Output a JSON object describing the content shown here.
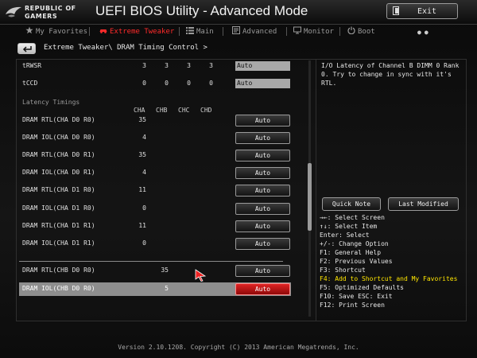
{
  "header": {
    "brand_line1": "REPUBLIC OF",
    "brand_line2": "GAMERS",
    "title": "UEFI BIOS Utility - Advanced Mode",
    "exit_label": "Exit"
  },
  "tabs": [
    {
      "label": "My Favorites",
      "icon": "star-icon",
      "active": false
    },
    {
      "label": "Extreme Tweaker",
      "icon": "car-icon",
      "active": true
    },
    {
      "label": "Main",
      "icon": "list-icon",
      "active": false
    },
    {
      "label": "Advanced",
      "icon": "advanced-icon",
      "active": false
    },
    {
      "label": "Monitor",
      "icon": "monitor-icon",
      "active": false
    },
    {
      "label": "Boot",
      "icon": "power-icon",
      "active": false
    }
  ],
  "breadcrumb": "Extreme Tweaker\\ DRAM Timing Control >",
  "timings_top": [
    {
      "label": "tRWSR",
      "values": [
        "3",
        "3",
        "3",
        "3"
      ],
      "setting": "Auto"
    },
    {
      "label": "tCCD",
      "values": [
        "0",
        "0",
        "0",
        "0"
      ],
      "setting": "Auto"
    }
  ],
  "latency_section": "Latency Timings",
  "columns": [
    "CHA",
    "CHB",
    "CHC",
    "CHD"
  ],
  "latency_rows": [
    {
      "label": "DRAM RTL(CHA D0 R0)",
      "value": "35",
      "button": "Auto"
    },
    {
      "label": "DRAM IOL(CHA D0 R0)",
      "value": "4",
      "button": "Auto"
    },
    {
      "label": "DRAM RTL(CHA D0 R1)",
      "value": "35",
      "button": "Auto"
    },
    {
      "label": "DRAM IOL(CHA D0 R1)",
      "value": "4",
      "button": "Auto"
    },
    {
      "label": "DRAM RTL(CHA D1 R0)",
      "value": "11",
      "button": "Auto"
    },
    {
      "label": "DRAM IOL(CHA D1 R0)",
      "value": "0",
      "button": "Auto"
    },
    {
      "label": "DRAM RTL(CHA D1 R1)",
      "value": "11",
      "button": "Auto"
    },
    {
      "label": "DRAM IOL(CHA D1 R1)",
      "value": "0",
      "button": "Auto"
    }
  ],
  "chb_rows": [
    {
      "label": "DRAM RTL(CHB D0 R0)",
      "value": "35",
      "button": "Auto",
      "selected": false
    },
    {
      "label": "DRAM IOL(CHB D0 R0)",
      "value": "5",
      "button": "Auto",
      "selected": true
    }
  ],
  "help": {
    "description": "I/O Latency of Channel B DIMM 0 Rank 0. Try to change in sync with it's RTL.",
    "quick_note": "Quick Note",
    "last_modified": "Last Modified",
    "hotkeys": [
      {
        "text": "→←: Select Screen",
        "highlight": false
      },
      {
        "text": "↑↓: Select Item",
        "highlight": false
      },
      {
        "text": "Enter: Select",
        "highlight": false
      },
      {
        "text": "+/-: Change Option",
        "highlight": false
      },
      {
        "text": "F1: General Help",
        "highlight": false
      },
      {
        "text": "F2: Previous Values",
        "highlight": false
      },
      {
        "text": "F3: Shortcut",
        "highlight": false
      },
      {
        "text": "F4: Add to Shortcut and My Favorites",
        "highlight": true
      },
      {
        "text": "F5: Optimized Defaults",
        "highlight": false
      },
      {
        "text": "F10: Save  ESC: Exit",
        "highlight": false
      },
      {
        "text": "F12: Print Screen",
        "highlight": false
      }
    ]
  },
  "footer": "Version 2.10.1208. Copyright (C) 2013 American Megatrends, Inc.",
  "colors": {
    "accent": "#ff2b2b",
    "highlight": "#ffe600",
    "selected_row": "#8e8e8e"
  }
}
